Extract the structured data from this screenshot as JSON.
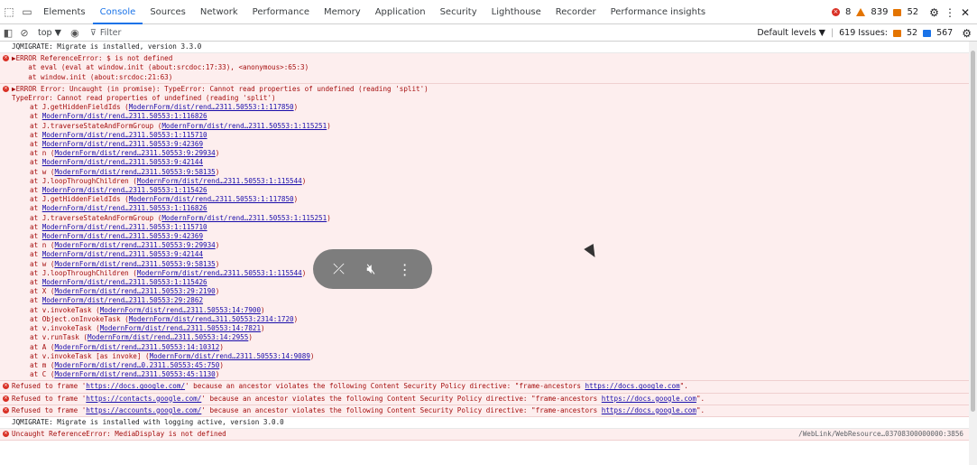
{
  "tabs": [
    {
      "label": "Elements"
    },
    {
      "label": "Console"
    },
    {
      "label": "Sources"
    },
    {
      "label": "Network"
    },
    {
      "label": "Performance"
    },
    {
      "label": "Memory"
    },
    {
      "label": "Application"
    },
    {
      "label": "Security"
    },
    {
      "label": "Lighthouse"
    },
    {
      "label": "Recorder"
    },
    {
      "label": "Performance insights"
    }
  ],
  "active_tab": "Console",
  "counters": {
    "errors": "8",
    "warnings": "839",
    "info": "52"
  },
  "toolbar": {
    "context": "top ▼",
    "filter_placeholder": "Filter",
    "levels": "Default levels ▼",
    "issues_label": "619 Issues:",
    "issues_warn": "52",
    "issues_info": "567"
  },
  "console": [
    {
      "type": "log",
      "text": "JQMIGRATE: Migrate is installed, version 3.3.0"
    },
    {
      "type": "error",
      "lines": [
        "▶ERROR ReferenceError: $ is not defined",
        "    at eval (eval at window.init (about:srcdoc:17:33), <anonymous>:65:3)",
        "    at window.init (about:srcdoc:21:63)"
      ]
    },
    {
      "type": "error",
      "lines": [
        "▶ERROR Error: Uncaught (in promise): TypeError: Cannot read properties of undefined (reading 'split')",
        "TypeError: Cannot read properties of undefined (reading 'split')"
      ],
      "stack": [
        [
          "at J.getHiddenFieldIds (",
          "ModernForm/dist/rend…2311.50553:1:117850",
          ")"
        ],
        [
          "at ",
          "ModernForm/dist/rend…2311.50553:1:116826",
          ""
        ],
        [
          "at J.traverseStateAndFormGroup (",
          "ModernForm/dist/rend…2311.50553:1:115251",
          ")"
        ],
        [
          "at ",
          "ModernForm/dist/rend…2311.50553:1:115710",
          ""
        ],
        [
          "at ",
          "ModernForm/dist/rend…2311.50553:9:42369",
          ""
        ],
        [
          "at n (",
          "ModernForm/dist/rend…2311.50553:9:29934",
          ")"
        ],
        [
          "at ",
          "ModernForm/dist/rend…2311.50553:9:42144",
          ""
        ],
        [
          "at w (",
          "ModernForm/dist/rend…2311.50553:9:58135",
          ")"
        ],
        [
          "at J.loopThroughChildren (",
          "ModernForm/dist/rend…2311.50553:1:115544",
          ")"
        ],
        [
          "at ",
          "ModernForm/dist/rend…2311.50553:1:115426",
          ""
        ],
        [
          "at J.getHiddenFieldIds (",
          "ModernForm/dist/rend…2311.50553:1:117850",
          ")"
        ],
        [
          "at ",
          "ModernForm/dist/rend…2311.50553:1:116826",
          ""
        ],
        [
          "at J.traverseStateAndFormGroup (",
          "ModernForm/dist/rend…2311.50553:1:115251",
          ")"
        ],
        [
          "at ",
          "ModernForm/dist/rend…2311.50553:1:115710",
          ""
        ],
        [
          "at ",
          "ModernForm/dist/rend…2311.50553:9:42369",
          ""
        ],
        [
          "at n (",
          "ModernForm/dist/rend…2311.50553:9:29934",
          ")"
        ],
        [
          "at ",
          "ModernForm/dist/rend…2311.50553:9:42144",
          ""
        ],
        [
          "at w (",
          "ModernForm/dist/rend…2311.50553:9:58135",
          ")"
        ],
        [
          "at J.loopThroughChildren (",
          "ModernForm/dist/rend…2311.50553:1:115544",
          ")"
        ],
        [
          "at ",
          "ModernForm/dist/rend…2311.50553:1:115426",
          ""
        ],
        [
          "at X (",
          "ModernForm/dist/rend…2311.50553:29:2190",
          ")"
        ],
        [
          "at ",
          "ModernForm/dist/rend…2311.50553:29:2862",
          ""
        ],
        [
          "at v.invokeTask (",
          "ModernForm/dist/rend…2311.50553:14:7900",
          ")"
        ],
        [
          "at Object.onInvokeTask (",
          "ModernForm/dist/rend…311.50553:2314:1720",
          ")"
        ],
        [
          "at v.invokeTask (",
          "ModernForm/dist/rend…2311.50553:14:7821",
          ")"
        ],
        [
          "at v.runTask (",
          "ModernForm/dist/rend…2311.50553:14:2955",
          ")"
        ],
        [
          "at A (",
          "ModernForm/dist/rend…2311.50553:14:10312",
          ")"
        ],
        [
          "at v.invokeTask [as invoke] (",
          "ModernForm/dist/rend…2311.50553:14:9089",
          ")"
        ],
        [
          "at m (",
          "ModernForm/dist/rend…0.2311.50553:45:750",
          ")"
        ],
        [
          "at C (",
          "ModernForm/dist/rend…2311.50553:45:1130",
          ")"
        ]
      ]
    },
    {
      "type": "error",
      "csp": true,
      "pre": "Refused to frame '",
      "url": "https://docs.google.com/",
      "mid": "' because an ancestor violates the following Content Security Policy directive: \"frame-ancestors ",
      "url2": "https://docs.google.com",
      "post": "\"."
    },
    {
      "type": "error",
      "csp": true,
      "pre": "Refused to frame '",
      "url": "https://contacts.google.com/",
      "mid": "' because an ancestor violates the following Content Security Policy directive: \"frame-ancestors ",
      "url2": "https://docs.google.com",
      "post": "\"."
    },
    {
      "type": "error",
      "csp": true,
      "pre": "Refused to frame '",
      "url": "https://accounts.google.com/",
      "mid": "' because an ancestor violates the following Content Security Policy directive: \"frame-ancestors ",
      "url2": "https://docs.google.com",
      "post": "\"."
    },
    {
      "type": "log",
      "text": "JQMIGRATE: Migrate is installed with logging active, version 3.0.0"
    },
    {
      "type": "error",
      "text": "Uncaught ReferenceError: MediaDisplay is not defined",
      "source": "/WebLink/WebResource…03708300000000:3856"
    }
  ]
}
